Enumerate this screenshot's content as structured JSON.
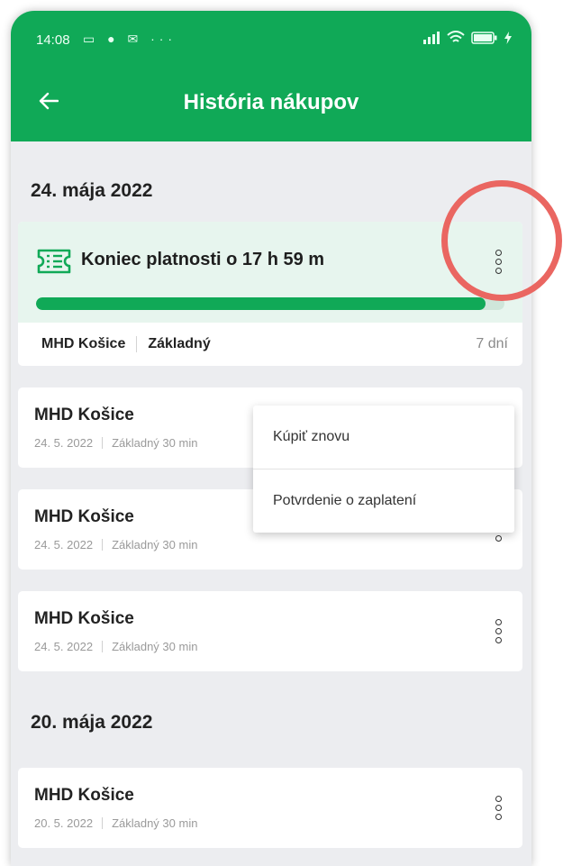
{
  "status_bar": {
    "time": "14:08",
    "left_icons": "▭ ● ✉ ···"
  },
  "app_bar": {
    "title": "História nákupov"
  },
  "sections": [
    {
      "date": "24. mája 2022"
    },
    {
      "date": "20. mája 2022"
    }
  ],
  "active_ticket": {
    "validity": "Koniec platnosti o 17 h 59 m",
    "progress_fraction": 0.96,
    "city": "MHD Košice",
    "type": "Základný",
    "duration": "7 dní"
  },
  "history": [
    {
      "title": "MHD Košice",
      "date": "24. 5. 2022",
      "type": "Základný 30 min"
    },
    {
      "title": "MHD Košice",
      "date": "24. 5. 2022",
      "type": "Základný 30 min"
    },
    {
      "title": "MHD Košice",
      "date": "24. 5. 2022",
      "type": "Základný 30 min"
    },
    {
      "title": "MHD Košice",
      "date": "20. 5. 2022",
      "type": "Základný 30 min"
    }
  ],
  "context_menu": {
    "items": [
      {
        "label": "Kúpiť znovu"
      },
      {
        "label": "Potvrdenie o zaplatení"
      }
    ]
  },
  "colors": {
    "brand_green": "#10a957",
    "highlight_ring": "#ea6661"
  }
}
